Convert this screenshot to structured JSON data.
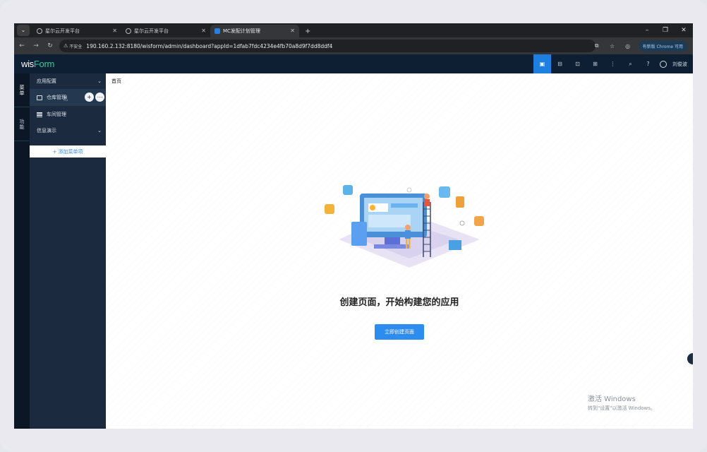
{
  "browser": {
    "tabs": [
      {
        "title": "星尔云开发平台"
      },
      {
        "title": "星尔云开发平台"
      },
      {
        "title": "MC发配计划管理"
      }
    ],
    "insecure_label": "不安全",
    "url": "190.160.2.132:8180/wisform/admin/dashboard?appId=1dfab7fdc4234e4fb70a8d9f7dd8ddf4",
    "chrome_pill": "有新版 Chrome 可用"
  },
  "app": {
    "logo_main": "wis",
    "logo_accent": "Form",
    "user_name": "刘俊波"
  },
  "rail": {
    "items": [
      {
        "label": "菜单"
      },
      {
        "label": "功能"
      }
    ]
  },
  "sidebar": {
    "group1": "应用配置",
    "items": [
      {
        "label": "仓库管理"
      },
      {
        "label": "车间管理"
      }
    ],
    "group2": "信息演示",
    "add_menu": "+ 添加菜单项"
  },
  "main": {
    "breadcrumb": "首页",
    "empty_title": "创建页面，开始构建您的应用",
    "create_button": "立即创建页面"
  },
  "watermark": {
    "line1": "激活 Windows",
    "line2": "转到\"设置\"以激活 Windows。"
  },
  "colors": {
    "primary": "#2d8cf0",
    "header_bg": "#0f1f33",
    "sidebar_bg": "#1b2a3e",
    "logo_accent": "#2ecc9a"
  }
}
